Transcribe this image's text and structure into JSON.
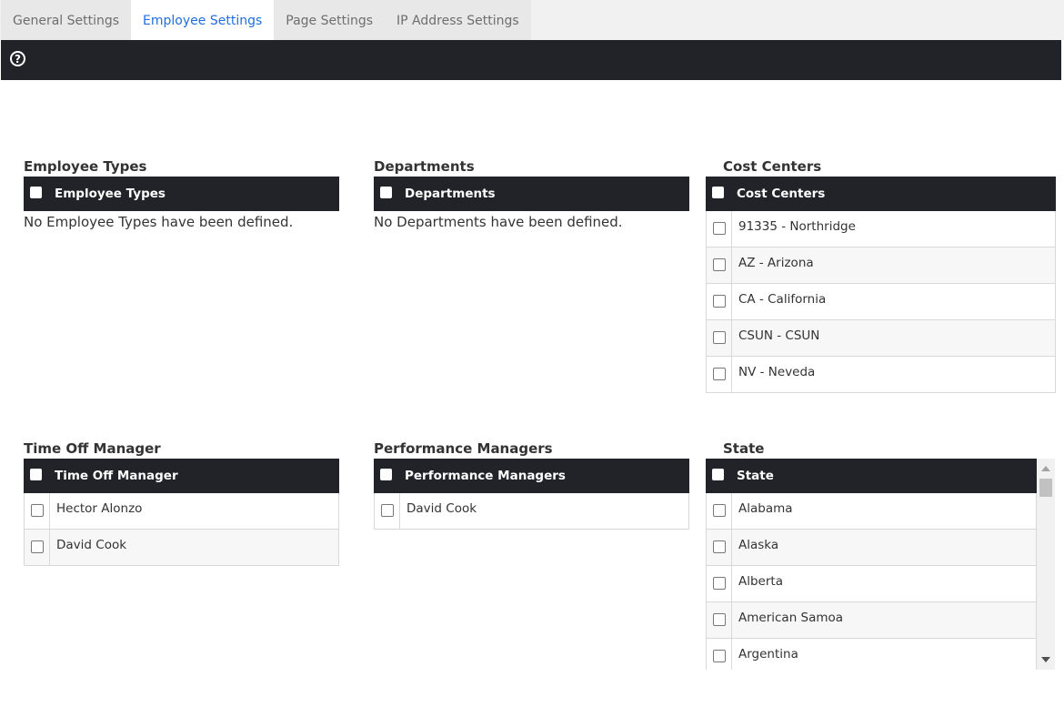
{
  "tabs": [
    {
      "label": "General Settings",
      "active": false
    },
    {
      "label": "Employee Settings",
      "active": true
    },
    {
      "label": "Page Settings",
      "active": false
    },
    {
      "label": "IP Address Settings",
      "active": false
    }
  ],
  "help": {
    "icon": "question-circle-icon",
    "glyph": "?"
  },
  "colors": {
    "header_bg": "#212328",
    "active_tab": "#1f6fe0"
  },
  "sections": {
    "employee_types": {
      "title": "Employee Types",
      "header": "Employee Types",
      "empty_message": "No Employee Types have been defined."
    },
    "departments": {
      "title": "Departments",
      "header": "Departments",
      "empty_message": "No Departments have been defined."
    },
    "cost_centers": {
      "title": "Cost Centers",
      "header": "Cost Centers",
      "rows": [
        "91335 - Northridge",
        "AZ - Arizona",
        "CA - California",
        "CSUN - CSUN",
        "NV - Neveda"
      ]
    },
    "time_off_manager": {
      "title": "Time Off Manager",
      "header": "Time Off Manager",
      "rows": [
        "Hector Alonzo",
        "David Cook"
      ]
    },
    "performance_managers": {
      "title": "Performance Managers",
      "header": "Performance Managers",
      "rows": [
        "David Cook"
      ]
    },
    "state": {
      "title": "State",
      "header": "State",
      "rows": [
        "Alabama",
        "Alaska",
        "Alberta",
        "American Samoa",
        "Argentina",
        ""
      ]
    }
  }
}
